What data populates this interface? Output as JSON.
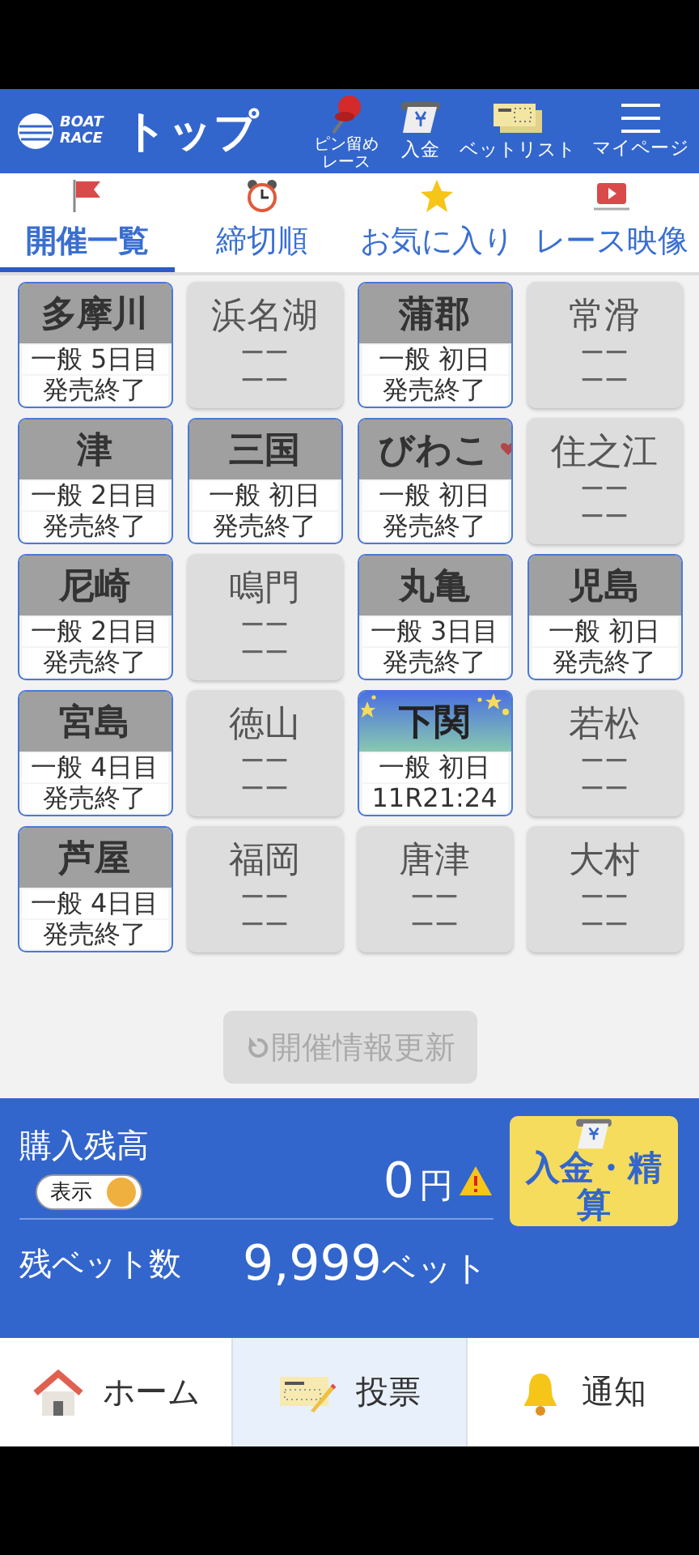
{
  "header": {
    "logo_text": [
      "BOAT",
      "RACE"
    ],
    "title": "トップ",
    "actions": [
      {
        "kind": "pin",
        "label": "ピン留めレース"
      },
      {
        "kind": "deposit",
        "label": "入金"
      },
      {
        "kind": "betlist",
        "label": "ベットリスト"
      },
      {
        "kind": "menu",
        "label": "マイページ"
      }
    ]
  },
  "tabs": [
    {
      "kind": "flag",
      "label": "開催一覧",
      "selected": true
    },
    {
      "kind": "clock",
      "label": "締切順",
      "selected": false
    },
    {
      "kind": "star",
      "label": "お気に入り",
      "selected": false
    },
    {
      "kind": "video",
      "label": "レース映像",
      "selected": false
    }
  ],
  "venues": [
    {
      "kind": "open",
      "name": "多摩川",
      "favorite": false,
      "lines": [
        "一般 5日目",
        "発売終了"
      ]
    },
    {
      "kind": "closed",
      "name": "浜名湖",
      "lines": [
        "ーー",
        "ーー"
      ]
    },
    {
      "kind": "open",
      "name": "蒲郡",
      "favorite": false,
      "lines": [
        "一般 初日",
        "発売終了"
      ]
    },
    {
      "kind": "closed",
      "name": "常滑",
      "lines": [
        "ーー",
        "ーー"
      ]
    },
    {
      "kind": "open",
      "name": "津",
      "favorite": false,
      "lines": [
        "一般 2日目",
        "発売終了"
      ]
    },
    {
      "kind": "open",
      "name": "三国",
      "favorite": false,
      "lines": [
        "一般 初日",
        "発売終了"
      ]
    },
    {
      "kind": "open",
      "name": "びわこ",
      "favorite": true,
      "lines": [
        "一般 初日",
        "発売終了"
      ]
    },
    {
      "kind": "closed",
      "name": "住之江",
      "lines": [
        "ーー",
        "ーー"
      ]
    },
    {
      "kind": "open",
      "name": "尼崎",
      "favorite": false,
      "lines": [
        "一般 2日目",
        "発売終了"
      ]
    },
    {
      "kind": "closed",
      "name": "鳴門",
      "lines": [
        "ーー",
        "ーー"
      ]
    },
    {
      "kind": "open",
      "name": "丸亀",
      "favorite": false,
      "lines": [
        "一般 3日目",
        "発売終了"
      ]
    },
    {
      "kind": "open",
      "name": "児島",
      "favorite": false,
      "lines": [
        "一般 初日",
        "発売終了"
      ]
    },
    {
      "kind": "open",
      "name": "宮島",
      "favorite": false,
      "lines": [
        "一般 4日目",
        "発売終了"
      ]
    },
    {
      "kind": "closed",
      "name": "徳山",
      "lines": [
        "ーー",
        "ーー"
      ]
    },
    {
      "kind": "night",
      "name": "下関",
      "favorite": false,
      "lines": [
        "一般 初日",
        "11R21:24"
      ]
    },
    {
      "kind": "closed",
      "name": "若松",
      "lines": [
        "ーー",
        "ーー"
      ]
    },
    {
      "kind": "open",
      "name": "芦屋",
      "favorite": false,
      "lines": [
        "一般 4日目",
        "発売終了"
      ]
    },
    {
      "kind": "closed",
      "name": "福岡",
      "lines": [
        "ーー",
        "ーー"
      ]
    },
    {
      "kind": "closed",
      "name": "唐津",
      "lines": [
        "ーー",
        "ーー"
      ]
    },
    {
      "kind": "closed",
      "name": "大村",
      "lines": [
        "ーー",
        "ーー"
      ]
    }
  ],
  "refresh_button": {
    "label": "開催情報更新",
    "disabled": true
  },
  "balance": {
    "label": "購入残高",
    "toggle": {
      "label": "表示",
      "on": true
    },
    "amount": "0",
    "unit": "円",
    "warning": true,
    "deposit_button": "入金・精算",
    "bets_label": "残ベット数",
    "bets_count": "9,999",
    "bets_unit": "ベット"
  },
  "bottom_nav": [
    {
      "kind": "home",
      "label": "ホーム",
      "selected": false
    },
    {
      "kind": "vote",
      "label": "投票",
      "selected": true
    },
    {
      "kind": "bell",
      "label": "通知",
      "selected": false
    }
  ]
}
